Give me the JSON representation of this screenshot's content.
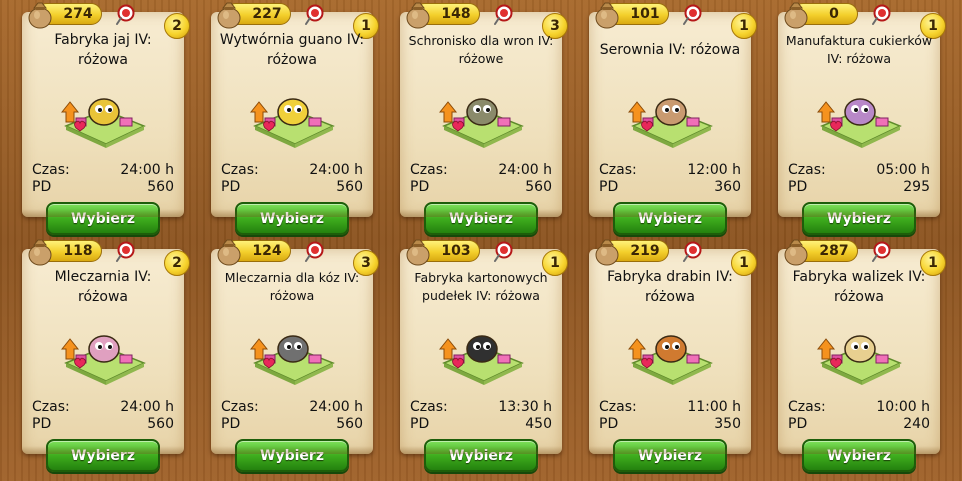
{
  "labels": {
    "time": "Czas:",
    "pd": "PD",
    "button": "Wybierz"
  },
  "cards": [
    {
      "price": "274",
      "count": "2",
      "title": "Fabryka jaj IV: różowa",
      "time": "24:00 h",
      "pd": "560",
      "icon": "chicken-farm-icon",
      "color": "#e9c438"
    },
    {
      "price": "227",
      "count": "1",
      "title": "Wytwórnia guano IV: różowa",
      "time": "24:00 h",
      "pd": "560",
      "icon": "guano-factory-icon",
      "color": "#f0d03a"
    },
    {
      "price": "148",
      "count": "3",
      "title": "Schronisko dla wron IV: różowe",
      "time": "24:00 h",
      "pd": "560",
      "icon": "crow-shelter-icon",
      "color": "#8a8a6a"
    },
    {
      "price": "101",
      "count": "1",
      "title": "Serownia IV: różowa",
      "time": "12:00 h",
      "pd": "360",
      "icon": "cheese-dairy-icon",
      "color": "#c99a70"
    },
    {
      "price": "0",
      "count": "1",
      "title": "Manufaktura cukierków IV: różowa",
      "time": "05:00 h",
      "pd": "295",
      "icon": "candy-factory-icon",
      "color": "#b888c8"
    },
    {
      "price": "118",
      "count": "2",
      "title": "Mleczarnia IV: różowa",
      "time": "24:00 h",
      "pd": "560",
      "icon": "dairy-icon",
      "color": "#e0a0c0"
    },
    {
      "price": "124",
      "count": "3",
      "title": "Mleczarnia dla kóz IV: różowa",
      "time": "24:00 h",
      "pd": "560",
      "icon": "goat-dairy-icon",
      "color": "#707070"
    },
    {
      "price": "103",
      "count": "1",
      "title": "Fabryka kartonowych pudełek IV: różowa",
      "time": "13:30 h",
      "pd": "450",
      "icon": "cardboard-box-factory-icon",
      "color": "#303030"
    },
    {
      "price": "219",
      "count": "1",
      "title": "Fabryka drabin IV: różowa",
      "time": "11:00 h",
      "pd": "350",
      "icon": "ladder-factory-icon",
      "color": "#d07a30"
    },
    {
      "price": "287",
      "count": "1",
      "title": "Fabryka walizek IV: różowa",
      "time": "10:00 h",
      "pd": "240",
      "icon": "suitcase-factory-icon",
      "color": "#e8d090"
    }
  ]
}
